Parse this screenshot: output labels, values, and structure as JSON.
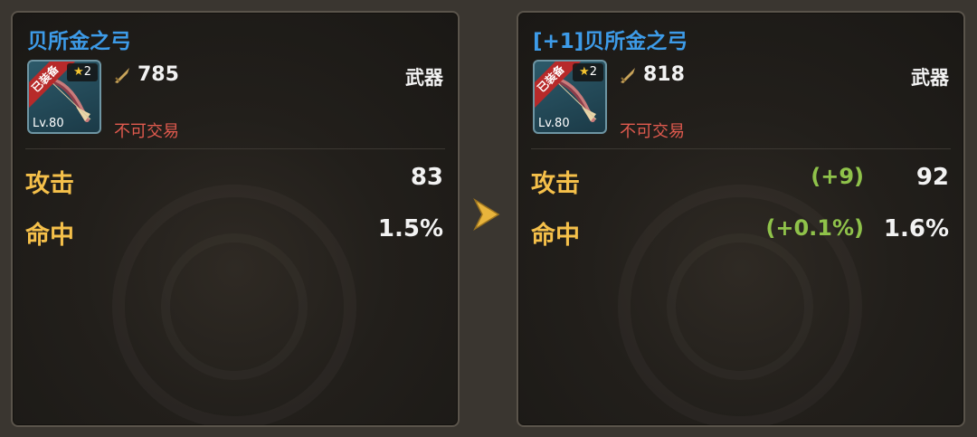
{
  "left": {
    "title": "贝所金之弓",
    "equipped_badge": "已装备",
    "star_count": "2",
    "level": "Lv.80",
    "power": "785",
    "trade_status": "不可交易",
    "item_type": "武器",
    "stats": [
      {
        "label": "攻击",
        "value": "83"
      },
      {
        "label": "命中",
        "value": "1.5%"
      }
    ]
  },
  "right": {
    "title": "[+1]贝所金之弓",
    "equipped_badge": "已装备",
    "star_count": "2",
    "level": "Lv.80",
    "power": "818",
    "trade_status": "不可交易",
    "item_type": "武器",
    "stats": [
      {
        "label": "攻击",
        "diff": "(+9)",
        "value": "92"
      },
      {
        "label": "命中",
        "diff": "(+0.1%)",
        "value": "1.6%"
      }
    ]
  },
  "colors": {
    "title": "#3d9be8",
    "stat_label": "#f5c04a",
    "trade_status": "#e05a4e",
    "diff": "#8fc24a",
    "arrow": "#e8b43c"
  },
  "icons": {
    "power": "sword-icon",
    "arrow": "chevron-right-icon",
    "item": "bow-icon",
    "star": "star-icon"
  }
}
